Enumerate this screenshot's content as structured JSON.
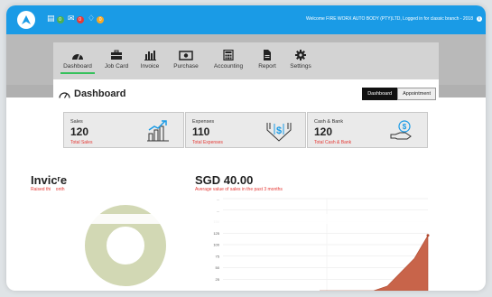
{
  "topbar": {
    "notifications": [
      {
        "icon": "list-icon",
        "count": "0",
        "color": "#4caf50"
      },
      {
        "icon": "mail-icon",
        "count": "0",
        "color": "#e53935"
      },
      {
        "icon": "bell-icon",
        "count": "0",
        "color": "#f9a825"
      }
    ],
    "welcome": "Welcome FIRE WORX AUTO BODY (PTY)LTD, Logged in for classic branch - 2018"
  },
  "nav": {
    "items": [
      {
        "label": "Dashboard",
        "icon": "speedometer-icon",
        "active": true
      },
      {
        "label": "Job Card",
        "icon": "briefcase-icon"
      },
      {
        "label": "Invoice",
        "icon": "bar-chart-icon"
      },
      {
        "label": "Purchase",
        "icon": "money-icon"
      },
      {
        "label": "Accounting",
        "icon": "calculator-icon"
      },
      {
        "label": "Report",
        "icon": "document-icon"
      },
      {
        "label": "Settings",
        "icon": "gear-icon"
      }
    ]
  },
  "dashboard": {
    "title": "Dashboard",
    "buttons": {
      "dashboard": "Dashboard",
      "appointment": "Appointment"
    }
  },
  "cards": [
    {
      "label": "Sales",
      "value": "120",
      "sub": "Total Sales",
      "icon": "sales-growth-icon"
    },
    {
      "label": "Expenses",
      "value": "110",
      "sub": "Total Expenses",
      "icon": "expenses-down-icon"
    },
    {
      "label": "Cash & Bank",
      "value": "120",
      "sub": "Total Cash & Bank",
      "icon": "cash-hand-icon"
    }
  ],
  "invoice": {
    "title": "Invicʳe",
    "subtitle": "Raised thi    onth"
  },
  "sales_panel": {
    "title": "SGD 40.00",
    "subtitle": "Average value of sales in the past 3 months"
  },
  "colors": {
    "accent": "#1a9be6",
    "red": "#e53935",
    "area": "#c8644a",
    "donut": "#d2d8b4"
  },
  "chart_data": {
    "type": "area",
    "yticks": [
      "25",
      "50",
      "75",
      "100",
      "125",
      "150",
      "...",
      "..."
    ],
    "ylim": [
      0,
      200
    ],
    "series": [
      {
        "values": [
          0,
          0,
          0,
          0,
          0,
          10,
          40,
          70,
          120
        ]
      }
    ]
  }
}
